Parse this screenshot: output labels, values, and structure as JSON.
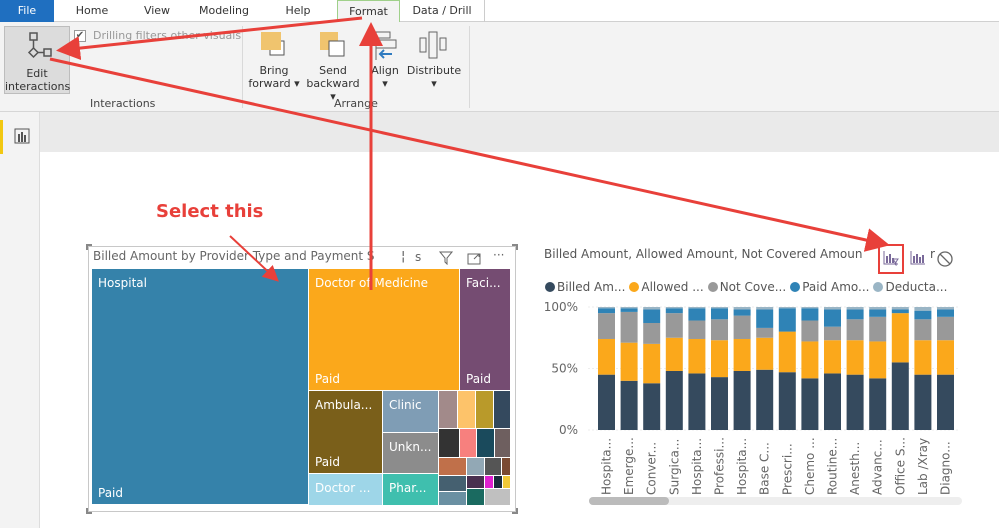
{
  "ribbon": {
    "tabs": [
      {
        "label": "File"
      },
      {
        "label": "Home"
      },
      {
        "label": "View"
      },
      {
        "label": "Modeling"
      },
      {
        "label": "Help"
      },
      {
        "label": "Format"
      },
      {
        "label": "Data / Drill"
      }
    ],
    "active_tab": "Format",
    "edit_interactions": {
      "line1": "Edit",
      "line2": "interactions"
    },
    "drilling_checkbox": {
      "label": "Drilling filters other visuals",
      "checked": true
    },
    "interactions_group": "Interactions",
    "bring_forward": {
      "line1": "Bring",
      "line2": "forward"
    },
    "send_backward": {
      "line1": "Send",
      "line2": "backward"
    },
    "align": "Align",
    "distribute": "Distribute",
    "arrange_group": "Arrange"
  },
  "annotation": {
    "text": "Select this",
    "color": "#e8403a"
  },
  "treemap": {
    "title": "Billed Amount by Provider Type and Payment S",
    "title_tail": "s",
    "tiles": [
      {
        "label": "Hospital",
        "sub": "Paid",
        "color": "#3582aa"
      },
      {
        "label": "Doctor of Medicine",
        "sub": "Paid",
        "color": "#fba81b"
      },
      {
        "label": "Faci...",
        "sub": "Paid",
        "color": "#754c72"
      },
      {
        "label": "Ambula...",
        "sub": "Paid",
        "color": "#7a5f1a"
      },
      {
        "label": "Clinic",
        "sub": "",
        "color": "#7f9db5"
      },
      {
        "label": "Unkn...",
        "sub": "",
        "color": "#8c8c8c"
      },
      {
        "label": "Doctor ...",
        "sub": "",
        "color": "#9ed6e8"
      },
      {
        "label": "Phar...",
        "sub": "",
        "color": "#3fbfae"
      }
    ]
  },
  "barchart": {
    "title": "Billed Amount, Allowed Amount, Not Covered Amoun",
    "title_tail": "r",
    "legend": [
      {
        "label": "Billed Am...",
        "color": "#354a5e"
      },
      {
        "label": "Allowed ...",
        "color": "#fba81b"
      },
      {
        "label": "Not Cove...",
        "color": "#999999"
      },
      {
        "label": "Paid Amo...",
        "color": "#2f83b6"
      },
      {
        "label": "Deducta...",
        "color": "#9ab5c5"
      }
    ]
  },
  "chart_data": {
    "type": "bar",
    "stacked": "100%",
    "yticks": [
      "100%",
      "50%",
      "0%"
    ],
    "ylim": [
      0,
      100
    ],
    "categories": [
      "Hospita...",
      "Emerge...",
      "Conver...",
      "Surgica...",
      "Hospita...",
      "Professi...",
      "Hospita...",
      "Base C...",
      "Prescri...",
      "Chemo ...",
      "Routine...",
      "Anesth...",
      "Advanc...",
      "Office S...",
      "Lab /Xray",
      "Diagno..."
    ],
    "series": [
      {
        "name": "Billed Am...",
        "values": [
          45,
          40,
          38,
          48,
          46,
          43,
          48,
          49,
          47,
          42,
          46,
          45,
          42,
          55,
          45,
          45
        ]
      },
      {
        "name": "Allowed ...",
        "values": [
          29,
          31,
          32,
          27,
          28,
          30,
          26,
          26,
          33,
          30,
          27,
          28,
          30,
          40,
          28,
          28
        ]
      },
      {
        "name": "Not Cove...",
        "values": [
          21,
          25,
          17,
          20,
          15,
          17,
          19,
          8,
          0,
          17,
          11,
          17,
          20,
          0,
          17,
          19
        ]
      },
      {
        "name": "Paid Amo...",
        "values": [
          4,
          3,
          11,
          4,
          10,
          9,
          5,
          15,
          19,
          10,
          14,
          8,
          6,
          3,
          7,
          6
        ]
      },
      {
        "name": "Deducta...",
        "values": [
          1,
          1,
          2,
          1,
          1,
          1,
          2,
          2,
          1,
          1,
          2,
          2,
          2,
          2,
          3,
          2
        ]
      }
    ]
  }
}
